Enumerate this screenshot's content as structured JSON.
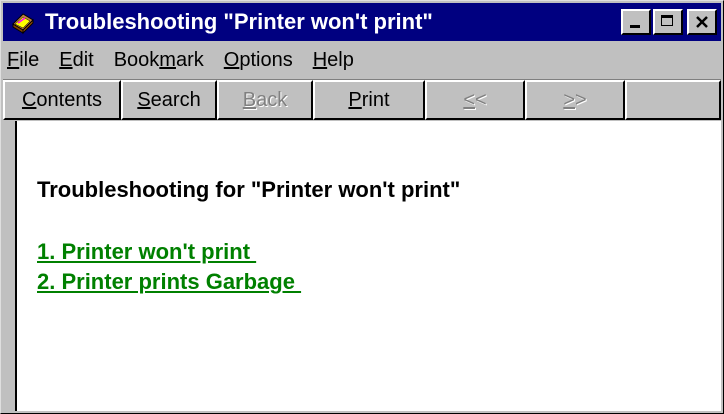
{
  "window": {
    "title": "Troubleshooting \"Printer won't print\"",
    "controls": [
      "minimize",
      "maximize",
      "close"
    ],
    "icon": "book-icon"
  },
  "menubar": {
    "items": [
      {
        "pre": "",
        "key": "F",
        "post": "ile"
      },
      {
        "pre": "",
        "key": "E",
        "post": "dit"
      },
      {
        "pre": "Book",
        "key": "m",
        "post": "ark"
      },
      {
        "pre": "",
        "key": "O",
        "post": "ptions"
      },
      {
        "pre": "",
        "key": "H",
        "post": "elp"
      }
    ]
  },
  "toolbar": {
    "buttons": [
      {
        "pre": "",
        "key": "C",
        "post": "ontents",
        "enabled": true
      },
      {
        "pre": "",
        "key": "S",
        "post": "earch",
        "enabled": true
      },
      {
        "pre": "",
        "key": "B",
        "post": "ack",
        "enabled": false
      },
      {
        "pre": "",
        "key": "P",
        "post": "rint",
        "enabled": true
      },
      {
        "pre": "",
        "key": "<",
        "post": "<",
        "enabled": false
      },
      {
        "pre": "",
        "key": ">",
        "post": ">",
        "enabled": false
      }
    ]
  },
  "content": {
    "heading": "Troubleshooting for \"Printer won't print\"",
    "links": [
      "1. Printer won't print ",
      "2. Printer prints Garbage "
    ]
  },
  "colors": {
    "titlebar": "#000080",
    "link": "#008000",
    "face": "#c0c0c0"
  }
}
